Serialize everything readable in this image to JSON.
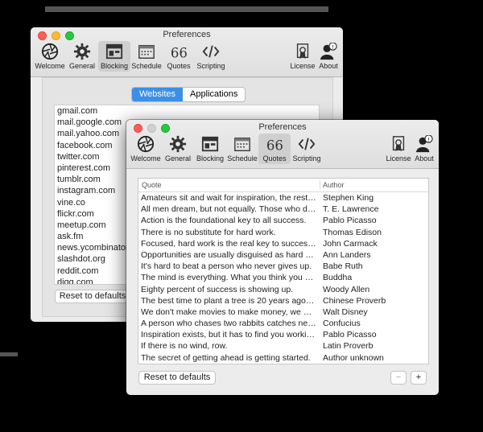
{
  "colors": {
    "close": "#fd5f57",
    "minimize": "#febc2e",
    "zoom": "#28c840",
    "inactive": "#d0d0d0",
    "accent": "#3b8fe6"
  },
  "back_window": {
    "title": "Preferences",
    "toolbar": [
      {
        "label": "Welcome",
        "icon": "aperture-icon"
      },
      {
        "label": "General",
        "icon": "gear-icon"
      },
      {
        "label": "Blocking",
        "icon": "browser-window-icon"
      },
      {
        "label": "Schedule",
        "icon": "calendar-icon"
      },
      {
        "label": "Quotes",
        "icon": "quote-icon"
      },
      {
        "label": "Scripting",
        "icon": "code-icon"
      },
      {
        "label": "License",
        "icon": "certificate-icon"
      },
      {
        "label": "About",
        "icon": "person-info-icon"
      }
    ],
    "selected_tab": "Blocking",
    "segment": {
      "websites": "Websites",
      "applications": "Applications"
    },
    "websites": [
      "gmail.com",
      "mail.google.com",
      "mail.yahoo.com",
      "facebook.com",
      "twitter.com",
      "pinterest.com",
      "tumblr.com",
      "instagram.com",
      "vine.co",
      "flickr.com",
      "meetup.com",
      "ask.fm",
      "news.ycombinator.com",
      "slashdot.org",
      "reddit.com",
      "digg.com"
    ],
    "reset_label": "Reset to defaults"
  },
  "front_window": {
    "title": "Preferences",
    "toolbar": [
      {
        "label": "Welcome",
        "icon": "aperture-icon"
      },
      {
        "label": "General",
        "icon": "gear-icon"
      },
      {
        "label": "Blocking",
        "icon": "browser-window-icon"
      },
      {
        "label": "Schedule",
        "icon": "calendar-icon"
      },
      {
        "label": "Quotes",
        "icon": "quote-icon"
      },
      {
        "label": "Scripting",
        "icon": "code-icon"
      },
      {
        "label": "License",
        "icon": "certificate-icon"
      },
      {
        "label": "About",
        "icon": "person-info-icon"
      }
    ],
    "selected_tab": "Quotes",
    "table": {
      "headers": {
        "quote": "Quote",
        "author": "Author"
      },
      "rows": [
        {
          "quote": "Amateurs sit and wait for inspiration, the rest o...",
          "author": "Stephen King"
        },
        {
          "quote": "All men dream, but not equally. Those who dre...",
          "author": "T. E. Lawrence"
        },
        {
          "quote": "Action is the foundational key to all success.",
          "author": "Pablo Picasso"
        },
        {
          "quote": "There is no substitute for hard work.",
          "author": "Thomas Edison"
        },
        {
          "quote": "Focused, hard work is the real key to success....",
          "author": "John Carmack"
        },
        {
          "quote": "Opportunities are usually disguised as hard wo...",
          "author": "Ann Landers"
        },
        {
          "quote": "It's hard to beat a person who never gives up.",
          "author": "Babe Ruth"
        },
        {
          "quote": "The mind is everything. What you think you be...",
          "author": "Buddha"
        },
        {
          "quote": "Eighty percent of success is showing up.",
          "author": "Woody Allen"
        },
        {
          "quote": "The best time to plant a tree is 20 years ago. T...",
          "author": "Chinese Proverb"
        },
        {
          "quote": "We don't make movies to make money, we mak...",
          "author": "Walt Disney"
        },
        {
          "quote": "A person who chases two rabbits catches neit...",
          "author": "Confucius"
        },
        {
          "quote": "Inspiration exists, but it has to find you working.",
          "author": "Pablo Picasso"
        },
        {
          "quote": "If there is no wind, row.",
          "author": "Latin Proverb"
        },
        {
          "quote": "The secret of getting ahead is getting started.",
          "author": "Author unknown"
        }
      ]
    },
    "reset_label": "Reset to defaults",
    "remove_label": "−",
    "add_label": "+"
  }
}
